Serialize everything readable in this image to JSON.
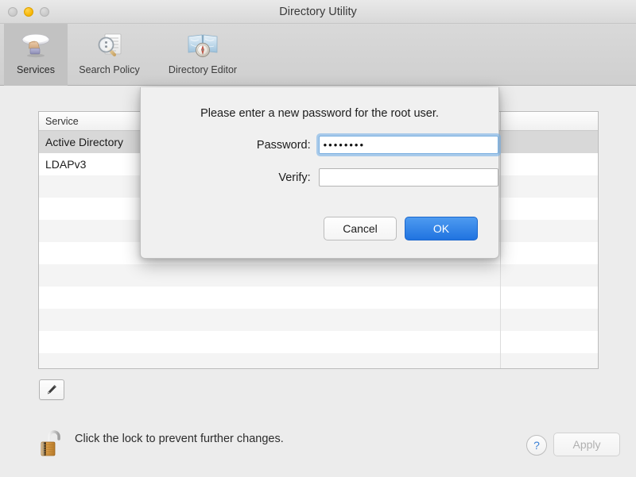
{
  "window": {
    "title": "Directory Utility",
    "traffic_lights": [
      {
        "name": "close",
        "state": "inactive"
      },
      {
        "name": "minimize",
        "state": "active"
      },
      {
        "name": "zoom",
        "state": "inactive"
      }
    ]
  },
  "toolbar": {
    "items": [
      {
        "label": "Services",
        "icon": "services-dish-icon",
        "selected": true
      },
      {
        "label": "Search Policy",
        "icon": "magnifier-document-icon",
        "selected": false
      },
      {
        "label": "Directory Editor",
        "icon": "atlas-compass-icon",
        "selected": false
      }
    ]
  },
  "table": {
    "columns": [
      "Service",
      ""
    ],
    "rows": [
      {
        "service": "Active Directory",
        "selected": true
      },
      {
        "service": "LDAPv3",
        "selected": false
      },
      {
        "service": "",
        "selected": false
      },
      {
        "service": "",
        "selected": false
      },
      {
        "service": "",
        "selected": false
      },
      {
        "service": "",
        "selected": false
      },
      {
        "service": "",
        "selected": false
      },
      {
        "service": "",
        "selected": false
      },
      {
        "service": "",
        "selected": false
      },
      {
        "service": "",
        "selected": false
      },
      {
        "service": "",
        "selected": false
      }
    ]
  },
  "edit_button": {
    "icon": "pencil-icon",
    "label": ""
  },
  "bottom": {
    "lock_icon": "open-padlock-icon",
    "lock_text": "Click the lock to prevent further changes.",
    "help_label": "?",
    "apply_label": "Apply",
    "apply_disabled": true
  },
  "sheet": {
    "message": "Please enter a new password for the root user.",
    "fields": [
      {
        "label": "Password:",
        "value": "••••••••",
        "placeholder": "",
        "focused": true
      },
      {
        "label": "Verify:",
        "value": "",
        "placeholder": "",
        "focused": false
      }
    ],
    "cancel_label": "Cancel",
    "ok_label": "OK"
  },
  "colors": {
    "accent_blue": "#2073e0",
    "help_blue": "#3a7fd5",
    "selected_row": "#d8d8d8",
    "window_bg": "#ececec",
    "focus_ring": "#6dabe6"
  }
}
